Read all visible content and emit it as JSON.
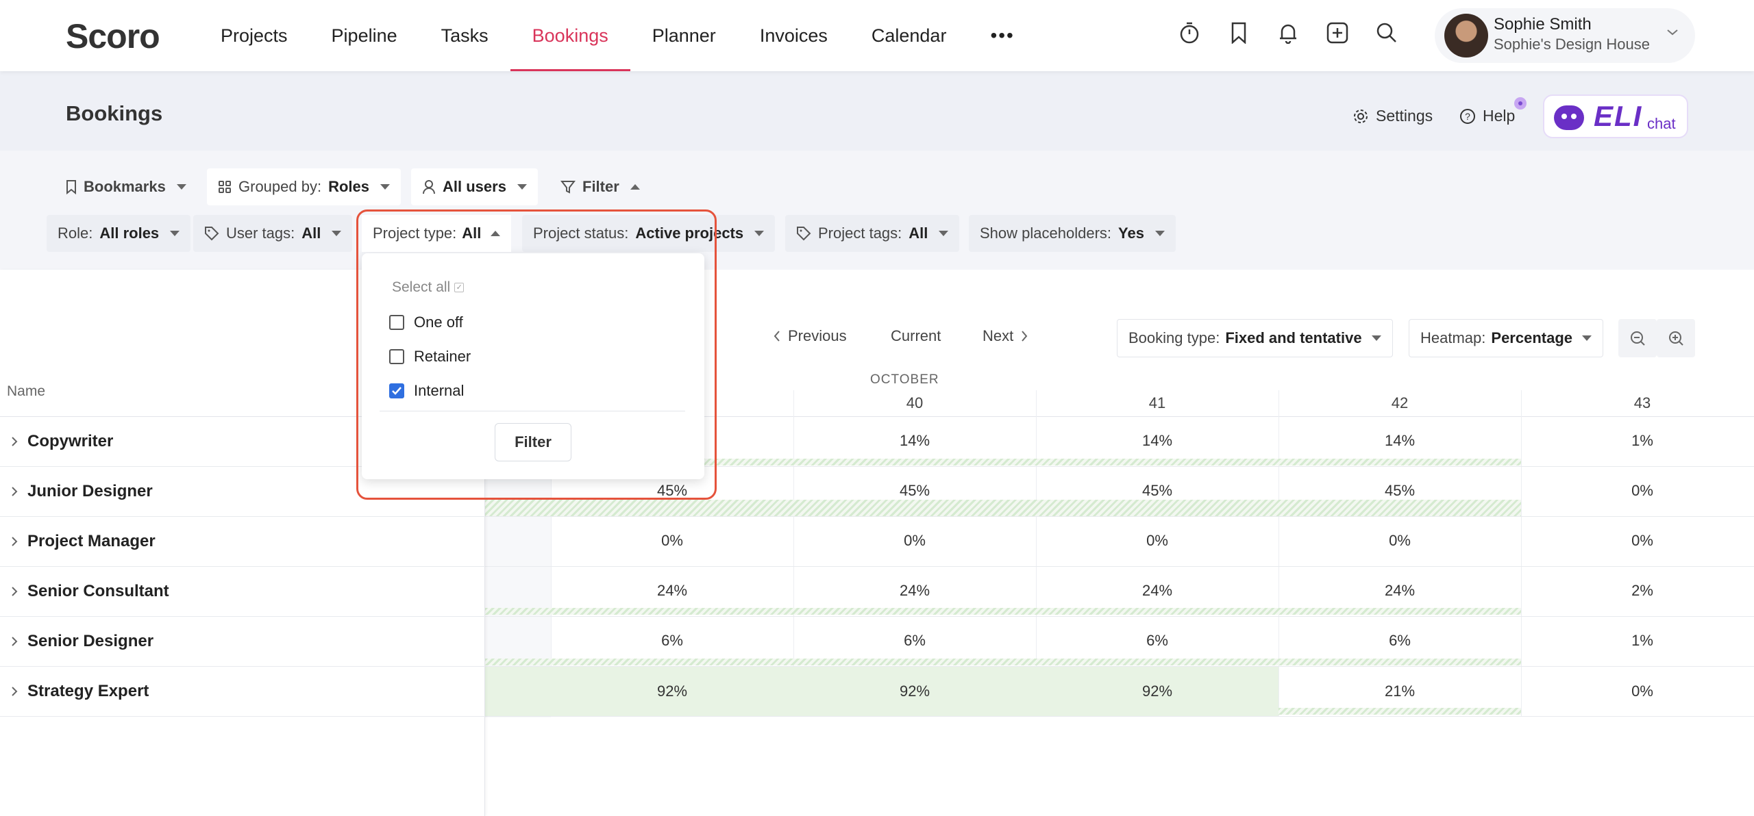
{
  "nav": {
    "logo": "Scoro",
    "items": [
      "Projects",
      "Pipeline",
      "Tasks",
      "Bookings",
      "Planner",
      "Invoices",
      "Calendar"
    ],
    "active": "Bookings",
    "more": "•••"
  },
  "user": {
    "name": "Sophie Smith",
    "company": "Sophie's Design House"
  },
  "header": {
    "title": "Bookings",
    "settings": "Settings",
    "help": "Help",
    "eli": "ELI",
    "eli_chat": "chat"
  },
  "toolbar": {
    "bookmarks": "Bookmarks",
    "grouped_label": "Grouped by:",
    "grouped_value": "Roles",
    "users": "All users",
    "filter": "Filter"
  },
  "filters": {
    "role_label": "Role:",
    "role_value": "All roles",
    "user_tags_label": "User tags:",
    "user_tags_value": "All",
    "project_type_label": "Project type:",
    "project_type_value": "All",
    "project_status_label": "Project status:",
    "project_status_value": "Active projects",
    "project_tags_label": "Project tags:",
    "project_tags_value": "All",
    "placeholders_label": "Show placeholders:",
    "placeholders_value": "Yes"
  },
  "dropdown": {
    "select_all": "Select all",
    "options": [
      {
        "label": "One off",
        "checked": false
      },
      {
        "label": "Retainer",
        "checked": false
      },
      {
        "label": "Internal",
        "checked": true
      }
    ],
    "button": "Filter"
  },
  "period_nav": {
    "previous": "Previous",
    "current": "Current",
    "next": "Next"
  },
  "booking_type": {
    "label": "Booking type:",
    "value": "Fixed and tentative"
  },
  "heatmap": {
    "label": "Heatmap:",
    "value": "Percentage"
  },
  "table": {
    "name_header": "Name",
    "month": "OCTOBER",
    "weeks": [
      "",
      "40",
      "41",
      "42",
      "43"
    ],
    "rows": [
      {
        "name": "Copywriter",
        "values": [
          "",
          "14%",
          "14%",
          "14%",
          "1%"
        ]
      },
      {
        "name": "Junior Designer",
        "values": [
          "45%",
          "45%",
          "45%",
          "45%",
          "0%"
        ]
      },
      {
        "name": "Project Manager",
        "values": [
          "0%",
          "0%",
          "0%",
          "0%",
          "0%"
        ]
      },
      {
        "name": "Senior Consultant",
        "values": [
          "24%",
          "24%",
          "24%",
          "24%",
          "2%"
        ]
      },
      {
        "name": "Senior Designer",
        "values": [
          "6%",
          "6%",
          "6%",
          "6%",
          "1%"
        ]
      },
      {
        "name": "Strategy Expert",
        "values": [
          "92%",
          "92%",
          "92%",
          "21%",
          "0%"
        ]
      }
    ]
  },
  "colors": {
    "accent": "#d9345a",
    "highlight_outline": "#e5533c",
    "heat_green": "#e8f3e4",
    "checkbox_blue": "#2f6fe0"
  }
}
